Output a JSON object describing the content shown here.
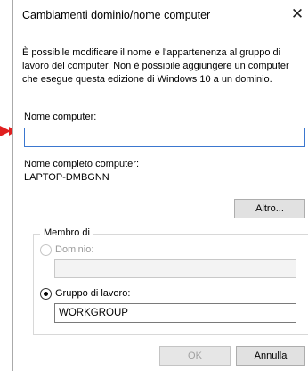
{
  "dialog": {
    "title": "Cambiamenti dominio/nome computer",
    "close_glyph": "✕",
    "description": "È possibile modificare il nome e l'appartenenza al gruppo di lavoro del computer. Non è possibile aggiungere un computer che esegue questa edizione di Windows 10 a un dominio."
  },
  "computer_name": {
    "label": "Nome computer:",
    "value": ""
  },
  "full_name": {
    "label": "Nome completo computer:",
    "value": "LAPTOP-DMBGNN"
  },
  "buttons": {
    "more": "Altro...",
    "ok": "OK",
    "cancel": "Annulla"
  },
  "member_of": {
    "label": "Membro di",
    "domain_label": "Dominio:",
    "domain_value": "",
    "workgroup_label": "Gruppo di lavoro:",
    "workgroup_value": "WORKGROUP",
    "selected": "workgroup"
  },
  "colors": {
    "arrow": "#e02020",
    "focus_border": "#3b77cf"
  }
}
